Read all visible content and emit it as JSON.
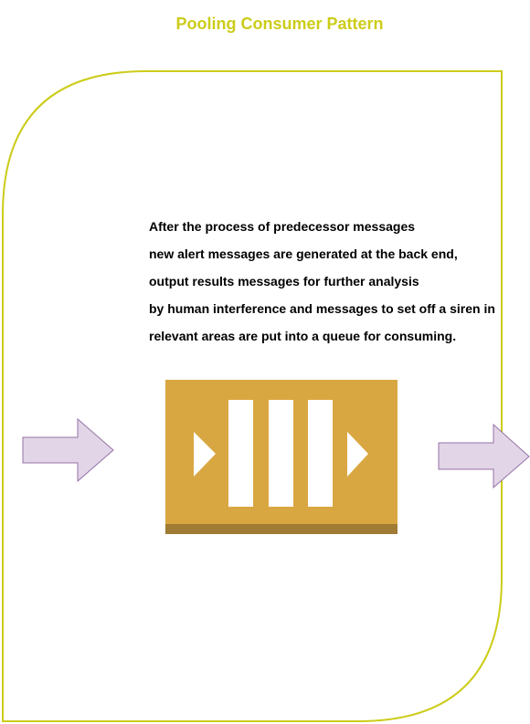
{
  "diagram": {
    "title": "Pooling Consumer Pattern",
    "description_lines": [
      "After the process of predecessor messages",
      "new alert messages are generated at the back end,",
      "output results messages for further analysis",
      "by human interference and messages to set off a siren in",
      "relevant areas are put into a queue for consuming."
    ],
    "icons": {
      "queue": "message-queue-icon",
      "input_arrow": "right-arrow-icon",
      "output_arrow": "right-arrow-icon"
    },
    "colors": {
      "title": "#cccc1a",
      "frame_stroke": "#cccc1a",
      "queue_fill": "#d9a741",
      "queue_base": "#a07b33",
      "arrow_fill": "#e1d5e7",
      "arrow_stroke": "#9673a6"
    }
  }
}
